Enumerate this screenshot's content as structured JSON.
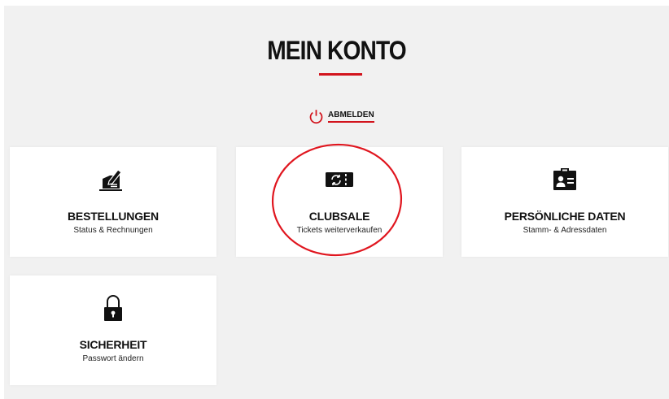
{
  "header": {
    "title": "MEIN KONTO",
    "logout_label": "ABMELDEN"
  },
  "cards": [
    {
      "title": "BESTELLUNGEN",
      "subtitle": "Status & Rechnungen",
      "icon": "pen-writing-icon"
    },
    {
      "title": "CLUBSALE",
      "subtitle": "Tickets weiterverkaufen",
      "icon": "ticket-refresh-icon"
    },
    {
      "title": "PERSÖNLICHE DATEN",
      "subtitle": "Stamm- & Adressdaten",
      "icon": "id-card-icon"
    },
    {
      "title": "SICHERHEIT",
      "subtitle": "Passwort ändern",
      "icon": "padlock-icon"
    }
  ],
  "colors": {
    "accent": "#d2141d",
    "background": "#f1f1f1",
    "card": "#ffffff",
    "text": "#111111"
  }
}
